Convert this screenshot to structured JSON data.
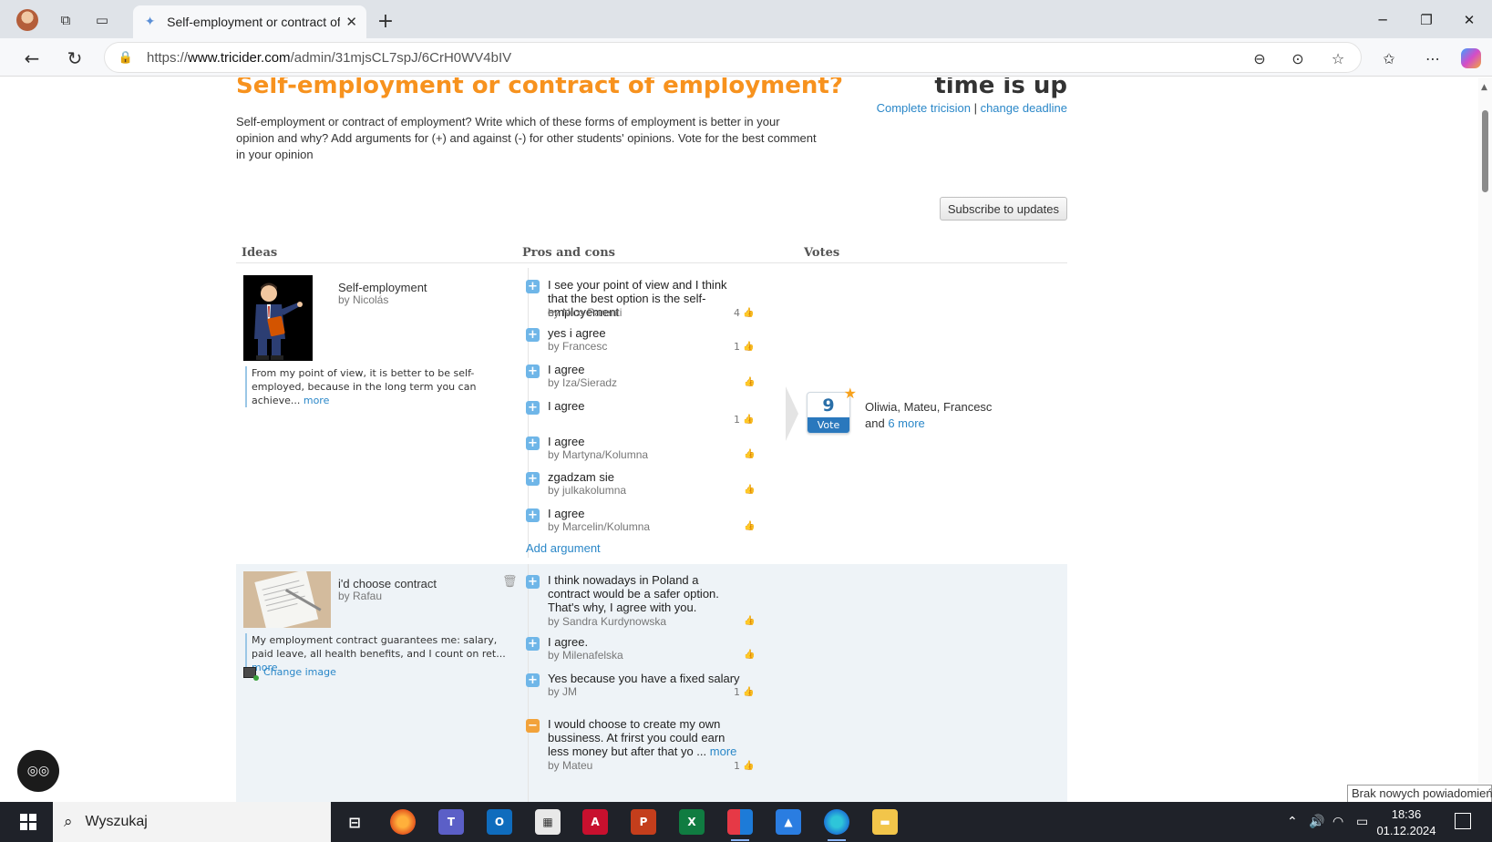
{
  "browser": {
    "tab_title": "Self-employment or contract of employment?",
    "tab_close": "✕",
    "new_tab": "+",
    "url_prefix": "https://",
    "url_domain": "www.tricider.com",
    "url_path": "/admin/31mjsCL7spJ/6CrH0WV4bIV"
  },
  "page": {
    "title": "Self-employment or contract of employment?",
    "status": "time is up",
    "complete_link": "Complete tricision",
    "separator": "|",
    "deadline_link": "change deadline",
    "description": "Self-employment or contract of employment? Write which of these forms of employment is better in your opinion and why? Add arguments for (+) and against (-) for other students' opinions. Vote for the best comment in your opinion",
    "subscribe_label": "Subscribe to updates",
    "columns": {
      "ideas": "Ideas",
      "pros_cons": "Pros and cons",
      "votes": "Votes"
    }
  },
  "ideas": [
    {
      "title": "Self-employment",
      "author": "by Nicolás",
      "description": "From my point of view, it is better to be self-employed, because in the long term you can achieve...",
      "more": "more",
      "arguments": [
        {
          "type": "plus",
          "text": "I see your point of view and I think that the best option is the self-employement",
          "author": "by Nico Parenti",
          "likes": "4"
        },
        {
          "type": "plus",
          "text": "yes i agree",
          "author": "by Francesc",
          "likes": "1"
        },
        {
          "type": "plus",
          "text": "I agree",
          "author": "by Iza/Sieradz",
          "likes": ""
        },
        {
          "type": "plus",
          "text": "I agree",
          "author": "",
          "likes": "1"
        },
        {
          "type": "plus",
          "text": "I agree",
          "author": "by Martyna/Kolumna",
          "likes": ""
        },
        {
          "type": "plus",
          "text": "zgadzam sie",
          "author": "by julkakolumna",
          "likes": ""
        },
        {
          "type": "plus",
          "text": "I agree",
          "author": "by Marcelin/Kolumna",
          "likes": ""
        }
      ],
      "add_argument": "Add argument",
      "votes": {
        "count": "9",
        "label": "Vote",
        "voters": "Oliwia, Mateu, Francesc",
        "and": "and",
        "more_link": "6 more"
      }
    },
    {
      "title": "i'd choose contract",
      "author": "by Rafau",
      "description": "My employment contract guarantees me: salary, paid leave, all health benefits, and I count on ret...",
      "more": "more",
      "change_image": "Change image",
      "arguments": [
        {
          "type": "plus",
          "text": "I think nowadays in Poland a contract would be a safer option. That's why, I agree with you.",
          "author": "by Sandra Kurdynowska",
          "likes": ""
        },
        {
          "type": "plus",
          "text": "I agree.",
          "author": "by Milenafelska",
          "likes": ""
        },
        {
          "type": "plus",
          "text": "Yes because you have a fixed salary",
          "author": "by JM",
          "likes": "1"
        },
        {
          "type": "minus",
          "text": "I would choose to create my own bussiness. At frirst you could earn less money but after that yo ...",
          "more": "more",
          "author": "by Mateu",
          "likes": "1"
        }
      ]
    }
  ],
  "taskbar": {
    "search_placeholder": "Wyszukaj",
    "time": "18:36",
    "date": "01.12.2024"
  },
  "toast": "Brak nowych powiadomień",
  "colors": {
    "accent_orange": "#f7921e",
    "link_blue": "#2a87c8",
    "plus": "#6fb6e8",
    "minus": "#f2a23a"
  }
}
